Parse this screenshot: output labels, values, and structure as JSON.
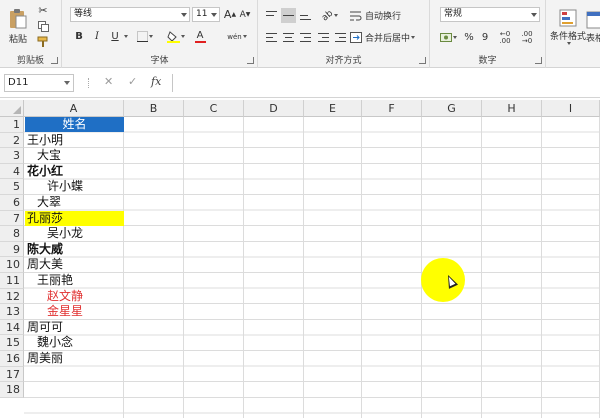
{
  "ribbon": {
    "clipboard": {
      "label": "剪贴板",
      "paste_label": "粘贴"
    },
    "font": {
      "label": "字体",
      "font_name": "等线",
      "font_size": "11",
      "bold": "B",
      "italic": "I",
      "underline": "U",
      "wen_label": "wén",
      "a_big": "A",
      "a_small": "A"
    },
    "alignment": {
      "label": "对齐方式",
      "wrap_text": "自动换行",
      "merge_center": "合并后居中"
    },
    "number": {
      "label": "数字",
      "format": "常规",
      "percent": "%",
      "comma": "9",
      "currency": "¥"
    },
    "styles": {
      "conditional_format": "条件格式",
      "format_table": "表格"
    }
  },
  "formula_bar": {
    "name_box": "D11",
    "cancel": "✕",
    "enter": "✓",
    "fx": "fx",
    "formula": ""
  },
  "grid": {
    "columns": [
      "A",
      "B",
      "C",
      "D",
      "E",
      "F",
      "G",
      "H",
      "I"
    ],
    "rows": [
      "1",
      "2",
      "3",
      "4",
      "5",
      "6",
      "7",
      "8",
      "9",
      "10",
      "11",
      "12",
      "13",
      "14",
      "15",
      "16",
      "17",
      "18"
    ],
    "cells": [
      {
        "text": "姓名",
        "style": "hdr",
        "indent": 0
      },
      {
        "text": "王小明",
        "style": "",
        "indent": 0
      },
      {
        "text": "大宝",
        "style": "",
        "indent": 1
      },
      {
        "text": "花小红",
        "style": "b",
        "indent": 0
      },
      {
        "text": "许小蝶",
        "style": "",
        "indent": 2
      },
      {
        "text": "大翠",
        "style": "",
        "indent": 1
      },
      {
        "text": "孔丽莎",
        "style": "yel",
        "indent": 0
      },
      {
        "text": "吴小龙",
        "style": "",
        "indent": 2
      },
      {
        "text": "陈大威",
        "style": "b",
        "indent": 0
      },
      {
        "text": "周大美",
        "style": "",
        "indent": 0
      },
      {
        "text": "王丽艳",
        "style": "",
        "indent": 1
      },
      {
        "text": "赵文静",
        "style": "red",
        "indent": 2
      },
      {
        "text": "金星星",
        "style": "red",
        "indent": 2
      },
      {
        "text": "周可可",
        "style": "",
        "indent": 0
      },
      {
        "text": "魏小念",
        "style": "",
        "indent": 1
      },
      {
        "text": "周美丽",
        "style": "",
        "indent": 0
      }
    ]
  },
  "colors": {
    "header_fill": "#1f6fc5",
    "highlight": "#ffff00",
    "red_text": "#e03030"
  }
}
